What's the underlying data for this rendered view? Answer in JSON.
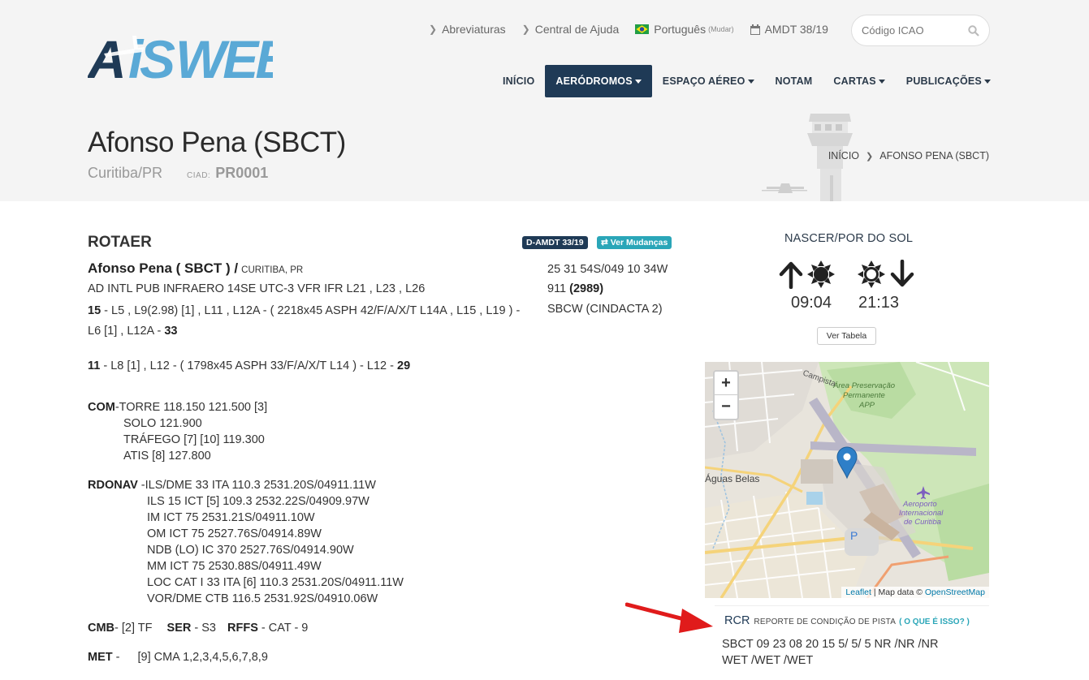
{
  "header": {
    "logo_text": "AISWEB",
    "toplinks": {
      "abreviaturas": "Abreviaturas",
      "ajuda": "Central de Ajuda",
      "lang": "Português",
      "lang_change": "(Mudar)",
      "amdt": "AMDT 38/19"
    },
    "search_placeholder": "Código ICAO",
    "nav": {
      "inicio": "INÍCIO",
      "aerodromos": "AERÓDROMOS",
      "espaco": "ESPAÇO AÉREO",
      "notam": "NOTAM",
      "cartas": "CARTAS",
      "publicacoes": "PUBLICAÇÕES"
    }
  },
  "title": {
    "name": "Afonso Pena (SBCT)",
    "city": "Curitiba/PR",
    "ciad_label": "CIAD:",
    "ciad_value": "PR0001"
  },
  "breadcrumb": {
    "home": "INÍCIO",
    "current": "AFONSO PENA (SBCT)"
  },
  "rotaer": {
    "title": "ROTAER",
    "badge_amdt": "D-AMDT 33/19",
    "badge_changes": "⇄ Ver Mudanças",
    "name": "Afonso Pena ( SBCT ) /",
    "name_city": "CURITIBA, PR",
    "line1": "AD INTL PUB INFRAERO 14SE UTC-3 VFR IFR L21 , L23 , L26",
    "rwy1_start": "15",
    "rwy1_a": " - L5 , L9(2.98) [1] , L11 , L12A - ( 2218x45 ASPH 42/F/A/X/T L14A , L15 , L19 ) -",
    "rwy1_b": "L6 [1] , L12A - ",
    "rwy1_end": "33",
    "rwy2_start": "11",
    "rwy2_a": " - L8 [1] , L12 - ( 1798x45 ASPH 33/F/A/X/T L14 ) - L12 - ",
    "rwy2_end": "29",
    "coord": "25 31 54S/049 10 34W",
    "elev": "911",
    "elev_ft": "(2989)",
    "fir": "SBCW (CINDACTA 2)",
    "com_label": "COM",
    "com": [
      "-TORRE 118.150 121.500 [3]",
      "SOLO 121.900",
      "TRÁFEGO [7] [10] 119.300",
      "ATIS [8] 127.800"
    ],
    "rdonav_label": "RDONAV",
    "rdonav": [
      "-ILS/DME 33 ITA 110.3 2531.20S/04911.11W",
      "ILS 15 ICT [5] 109.3 2532.22S/04909.97W",
      "IM ICT 75 2531.21S/04911.10W",
      "OM ICT 75 2527.76S/04914.89W",
      "NDB (LO) IC 370 2527.76S/04914.90W",
      "MM ICT 75 2530.88S/04911.49W",
      "LOC CAT I 33 ITA [6] 110.3 2531.20S/04911.11W",
      "VOR/DME CTB 116.5 2531.92S/04910.06W"
    ],
    "cmb_label": "CMB",
    "cmb_value": "- [2] TF",
    "ser_label": "SER",
    "ser_value": "- S3",
    "rffs_label": "RFFS",
    "rffs_value": "- CAT - 9",
    "met_label": "MET",
    "met_dash": "-",
    "met_value": "[9] CMA 1,2,3,4,5,6,7,8,9"
  },
  "sun": {
    "title": "NASCER/POR DO SOL",
    "sunrise": "09:04",
    "sunset": "21:13",
    "table_button": "Ver Tabela"
  },
  "map": {
    "zoom_in": "+",
    "zoom_out": "−",
    "labels": {
      "campista": "Campista",
      "area1": "Área Preservação",
      "area2": "Permanente",
      "area3": "APP",
      "aguas": "Águas Belas",
      "aero1": "Aeroporto",
      "aero2": "Internacional",
      "aero3": "de Curitiba",
      "parking": "P"
    },
    "attrib_leaflet": "Leaflet",
    "attrib_sep": " | Map data © ",
    "attrib_osm": "OpenStreetMap"
  },
  "rcr": {
    "label": "RCR",
    "desc": "REPORTE DE CONDIÇÃO DE PISTA",
    "help": "( O QUE É ISSO? )",
    "line1": "SBCT 09 23 08 20 15 5/ 5/ 5 NR /NR /NR",
    "line2": "WET /WET /WET"
  },
  "colors": {
    "nav_active": "#1f3a56",
    "accent_teal": "#2aa6b8",
    "logo_dark": "#1f3a56",
    "logo_light": "#5aa9d6",
    "arrow_red": "#e01b1b"
  }
}
